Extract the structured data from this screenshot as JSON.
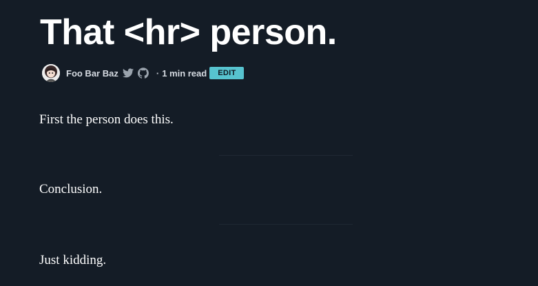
{
  "post": {
    "title": "That <hr> person.",
    "author": "Foo Bar Baz",
    "separator": "·",
    "read_time": "1 min read",
    "edit_label": "EDIT"
  },
  "icons": {
    "twitter": "twitter-icon",
    "github": "github-icon"
  },
  "content": {
    "paragraph_1": "First the person does this.",
    "paragraph_2": "Conclusion.",
    "paragraph_3": "Just kidding."
  },
  "colors": {
    "background": "#141c26",
    "text": "#ffffff",
    "meta_text": "#d6dbe2",
    "edit_badge": "#57c3cf",
    "rule": "#1f2833"
  }
}
